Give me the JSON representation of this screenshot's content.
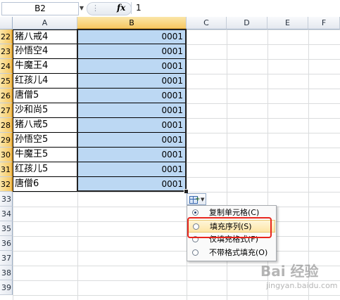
{
  "formula_bar": {
    "name_box": "B2",
    "fx": "fx",
    "value": "1"
  },
  "columns": [
    "A",
    "B",
    "C",
    "D",
    "E",
    "F"
  ],
  "rows": [
    {
      "num": "22",
      "a": "猪八戒4",
      "b": "0001"
    },
    {
      "num": "23",
      "a": "孙悟空4",
      "b": "0001"
    },
    {
      "num": "24",
      "a": "牛魔王4",
      "b": "0001"
    },
    {
      "num": "25",
      "a": "红孩儿4",
      "b": "0001"
    },
    {
      "num": "26",
      "a": "唐僧5",
      "b": "0001"
    },
    {
      "num": "27",
      "a": "沙和尚5",
      "b": "0001"
    },
    {
      "num": "28",
      "a": "猪八戒5",
      "b": "0001"
    },
    {
      "num": "29",
      "a": "孙悟空5",
      "b": "0001"
    },
    {
      "num": "30",
      "a": "牛魔王5",
      "b": "0001"
    },
    {
      "num": "31",
      "a": "红孩儿5",
      "b": "0001"
    },
    {
      "num": "32",
      "a": "唐僧6",
      "b": "0001"
    },
    {
      "num": "33",
      "a": "",
      "b": ""
    },
    {
      "num": "34",
      "a": "",
      "b": ""
    },
    {
      "num": "35",
      "a": "",
      "b": ""
    },
    {
      "num": "36",
      "a": "",
      "b": ""
    },
    {
      "num": "37",
      "a": "",
      "b": ""
    },
    {
      "num": "38",
      "a": "",
      "b": ""
    },
    {
      "num": "39",
      "a": "",
      "b": ""
    }
  ],
  "autofill_menu": {
    "items": [
      {
        "label": "复制单元格(C)",
        "checked": true
      },
      {
        "label": "填充序列(S)",
        "checked": false
      },
      {
        "label": "仅填充格式(F)",
        "checked": false
      },
      {
        "label": "不带格式填充(O)",
        "checked": false
      }
    ]
  },
  "watermark": {
    "text": "Bai 经验",
    "sub": "jingyan.baidu.com"
  }
}
